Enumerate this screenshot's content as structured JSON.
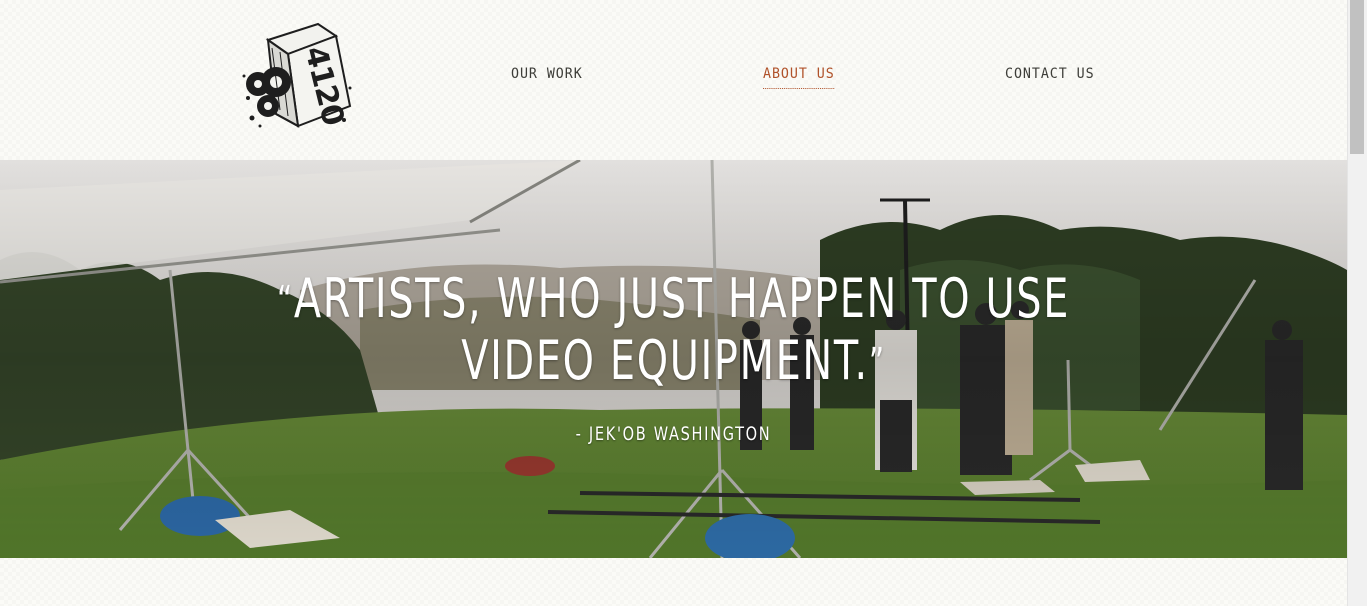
{
  "brand": {
    "logo_text": "4120"
  },
  "nav": {
    "items": [
      {
        "label": "OUR WORK",
        "active": false
      },
      {
        "label": "ABOUT US",
        "active": true
      },
      {
        "label": "CONTACT US",
        "active": false
      }
    ],
    "active_color": "#b0522a",
    "text_color": "#3d3d38"
  },
  "hero": {
    "quote_open": "“",
    "quote_line1": "ARTISTS, WHO JUST HAPPEN TO USE",
    "quote_line2": "VIDEO EQUIPMENT.",
    "quote_close": "”",
    "attribution": "-  JEK'OB WASHINGTON"
  }
}
